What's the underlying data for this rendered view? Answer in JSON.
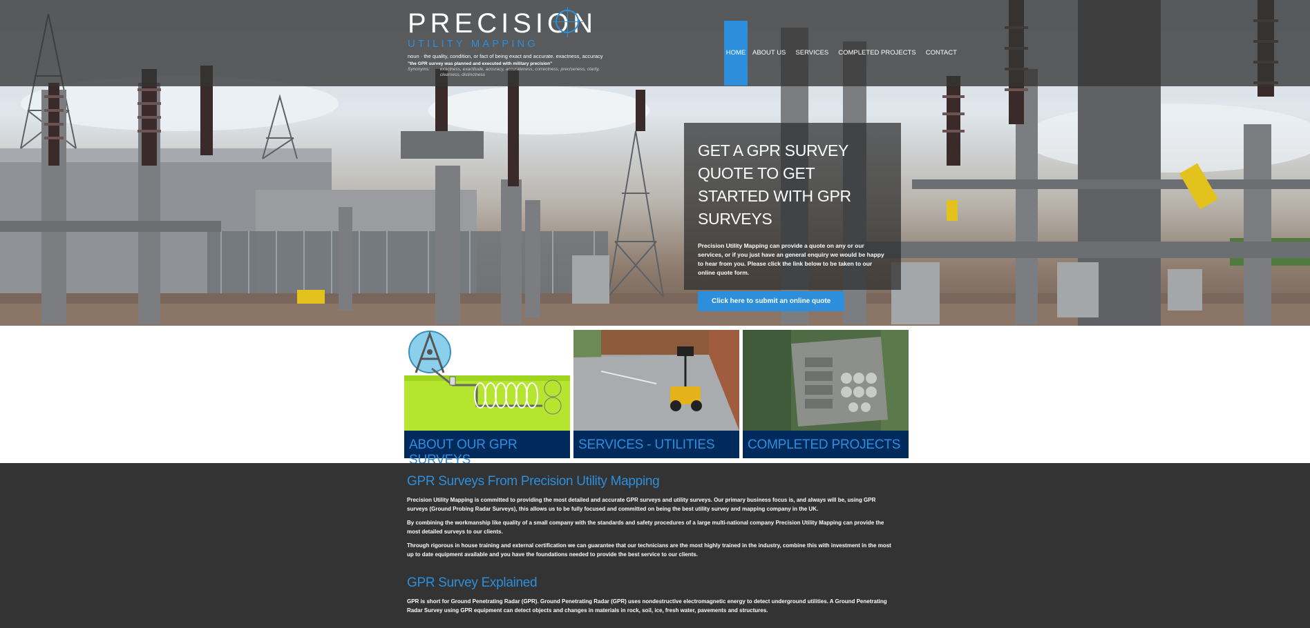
{
  "logo": {
    "main_text": "PRECISION",
    "sub_text": "UTILITY MAPPING",
    "definition": "noun · the quality, condition, or fact of being exact and accurate. exactness, accuracy",
    "quote": "\"the GPR survey was planned and executed with military precision\"",
    "synonyms_label": "Synonyms:",
    "synonyms": "exactness, exactitude, accuracy, accurateness, correctness, preciseness, clarity, clearness, distinctness"
  },
  "nav": {
    "items": [
      "HOME",
      "ABOUT US",
      "SERVICES",
      "COMPLETED PROJECTS",
      "CONTACT"
    ],
    "active": "HOME"
  },
  "hero": {
    "title": "GET A GPR SURVEY QUOTE TO GET STARTED WITH GPR SURVEYS",
    "text": "Precision Utility Mapping can provide a quote on any or our services, or if you just have an general enquiry we would be happy to hear from you. Please click the link below to be taken to our online quote form.",
    "button_label": "Click here to submit an online quote"
  },
  "tiles": [
    {
      "label": "ABOUT OUR GPR SURVEYS",
      "image": "gpr-diagram-illustration"
    },
    {
      "label": "SERVICES - UTILITIES",
      "image": "gpr-cart-photo"
    },
    {
      "label": "COMPLETED PROJECTS",
      "image": "aerial-site-photo"
    }
  ],
  "content": {
    "heading1": "GPR Surveys From Precision Utility Mapping",
    "para1": "Precision Utility Mapping is committed to providing the most detailed and accurate GPR surveys and utility surveys. Our primary business focus is, and always will be, using GPR surveys (Ground Probing Radar Surveys), this allows us to be fully focused and committed on being the best utility survey and mapping company in the UK.",
    "para2": "By combining the workmanship like quality of a small company with the standards and safety procedures of a large multi-national company Precision Utility Mapping can provide the most detailed surveys to our clients.",
    "para3": "Through rigorous in house training and external certification we can guarantee that our technicians are the most highly trained in the industry, combine this with investment in the most up to date equipment available and you have the foundations needed to provide the best service to our clients.",
    "heading2": "GPR Survey Explained",
    "para4": "GPR is short for Ground Penetrating Radar (GPR). Ground Penetrating Radar (GPR) uses nondestructive electromagnetic energy to detect underground utilities. A Ground Penetrating Radar Survey using GPR equipment can detect objects and changes in materials in rock, soil, ice, fresh water, pavements and structures."
  },
  "colors": {
    "accent": "#2d8fdc",
    "tile_bar": "#002a5c",
    "content_bg": "#333333",
    "topbar": "#343434"
  }
}
